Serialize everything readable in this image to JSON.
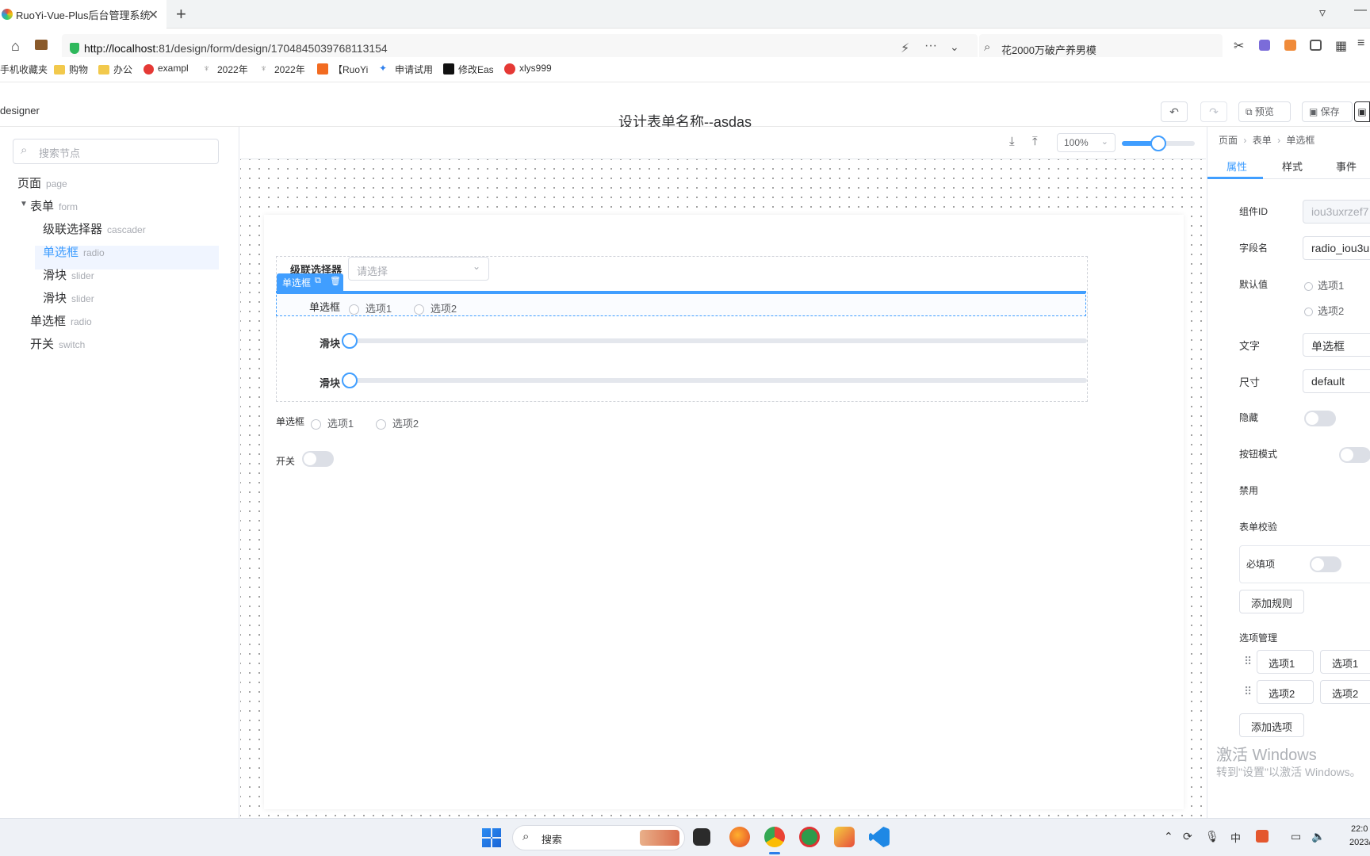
{
  "browser": {
    "tab_title": "RuoYi-Vue-Plus后台管理系统",
    "url_host": "http://localhost",
    "url_rest": ":81/design/form/design/1704845039768113154",
    "search_text": "花2000万破产养男模",
    "bookmarks": [
      "手机收藏夹",
      "购物",
      "办公",
      "exampl",
      "2022年",
      "2022年",
      "【RuoYi",
      "申请试用",
      "修改Eas",
      "xlys999"
    ]
  },
  "header": {
    "app_name": "designer",
    "title": "设计表单名称--asdas",
    "preview_label": "预览",
    "save_label": "保存"
  },
  "left": {
    "search_placeholder": "搜索节点",
    "nodes": [
      {
        "label": "页面",
        "type": "page"
      },
      {
        "label": "表单",
        "type": "form"
      },
      {
        "label": "级联选择器",
        "type": "cascader"
      },
      {
        "label": "单选框",
        "type": "radio"
      },
      {
        "label": "滑块",
        "type": "slider"
      },
      {
        "label": "滑块",
        "type": "slider"
      },
      {
        "label": "单选框",
        "type": "radio"
      },
      {
        "label": "开关",
        "type": "switch"
      }
    ]
  },
  "toolbar": {
    "zoom": "100%",
    "zoom_slider_value": 0.5
  },
  "canvas": {
    "cascader_label": "级联选择器",
    "cascader_placeholder": "请选择",
    "selected_tag": "单选框",
    "radio_label": "单选框",
    "radio_options": [
      "选项1",
      "选项2"
    ],
    "slider1_label": "滑块",
    "slider2_label": "滑块",
    "radio2_label": "单选框",
    "radio2_options": [
      "选项1",
      "选项2"
    ],
    "switch_label": "开关"
  },
  "right": {
    "breadcrumb": [
      "页面",
      "表单",
      "单选框"
    ],
    "tabs": [
      "属性",
      "样式",
      "事件"
    ],
    "props": {
      "id_label": "组件ID",
      "id_value": "iou3uxrzef7",
      "field_label": "字段名",
      "field_value": "radio_iou3u",
      "default_label": "默认值",
      "default_options": [
        "选项1",
        "选项2"
      ],
      "text_label": "文字",
      "text_value": "单选框",
      "size_label": "尺寸",
      "size_value": "default",
      "hidden_label": "隐藏",
      "button_mode_label": "按钮模式",
      "disabled_label": "禁用",
      "validation_label": "表单校验",
      "required_label": "必填项",
      "add_rule_label": "添加规则",
      "options_label": "选项管理",
      "option_rows": [
        [
          "选项1",
          "选项1"
        ],
        [
          "选项2",
          "选项2"
        ]
      ],
      "add_option_label": "添加选项"
    }
  },
  "watermark": {
    "line1": "激活 Windows",
    "line2": "转到\"设置\"以激活 Windows。"
  },
  "taskbar": {
    "search_label": "搜索",
    "time": "22:0",
    "date": "2023/"
  }
}
